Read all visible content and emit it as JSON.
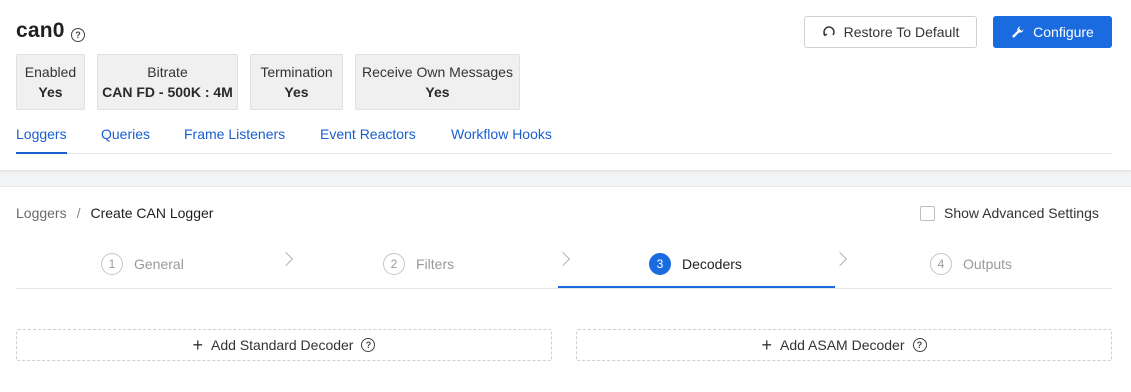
{
  "header": {
    "title": "can0",
    "help_icon": "question-circle-icon",
    "restore_label": "Restore To Default",
    "restore_icon": "reset-icon",
    "configure_label": "Configure",
    "configure_icon": "wrench-icon"
  },
  "info": [
    {
      "label": "Enabled",
      "value": "Yes"
    },
    {
      "label": "Bitrate",
      "value": "CAN FD - 500K : 4M"
    },
    {
      "label": "Termination",
      "value": "Yes"
    },
    {
      "label": "Receive Own Messages",
      "value": "Yes"
    }
  ],
  "tabs": [
    {
      "label": "Loggers",
      "active": true
    },
    {
      "label": "Queries",
      "active": false
    },
    {
      "label": "Frame Listeners",
      "active": false
    },
    {
      "label": "Event Reactors",
      "active": false
    },
    {
      "label": "Workflow Hooks",
      "active": false
    }
  ],
  "breadcrumb": {
    "parent": "Loggers",
    "separator": "/",
    "current": "Create CAN Logger"
  },
  "advanced": {
    "label": "Show Advanced Settings",
    "checked": false
  },
  "steps": [
    {
      "num": "1",
      "label": "General",
      "active": false
    },
    {
      "num": "2",
      "label": "Filters",
      "active": false
    },
    {
      "num": "3",
      "label": "Decoders",
      "active": true
    },
    {
      "num": "4",
      "label": "Outputs",
      "active": false
    }
  ],
  "actions": {
    "standard_label": "Add Standard Decoder",
    "asam_label": "Add ASAM Decoder"
  },
  "colors": {
    "accent": "#1a6be0",
    "link": "#1a5fcf"
  }
}
